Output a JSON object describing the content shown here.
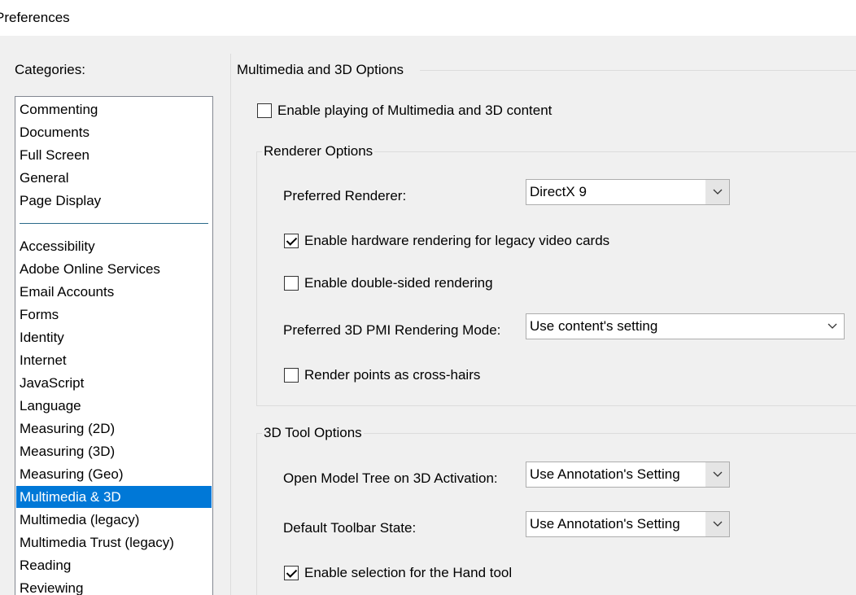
{
  "window": {
    "title": "Preferences"
  },
  "categories": {
    "label": "Categories:",
    "top_items": [
      {
        "label": "Commenting"
      },
      {
        "label": "Documents"
      },
      {
        "label": "Full Screen"
      },
      {
        "label": "General"
      },
      {
        "label": "Page Display"
      }
    ],
    "items": [
      {
        "label": "Accessibility"
      },
      {
        "label": "Adobe Online Services"
      },
      {
        "label": "Email Accounts"
      },
      {
        "label": "Forms"
      },
      {
        "label": "Identity"
      },
      {
        "label": "Internet"
      },
      {
        "label": "JavaScript"
      },
      {
        "label": "Language"
      },
      {
        "label": "Measuring (2D)"
      },
      {
        "label": "Measuring (3D)"
      },
      {
        "label": "Measuring (Geo)"
      },
      {
        "label": "Multimedia & 3D",
        "selected": true
      },
      {
        "label": "Multimedia (legacy)"
      },
      {
        "label": "Multimedia Trust (legacy)"
      },
      {
        "label": "Reading"
      },
      {
        "label": "Reviewing"
      }
    ]
  },
  "panel": {
    "title": "Multimedia and 3D Options",
    "enable_playing": {
      "label": "Enable playing of Multimedia and 3D content",
      "checked": false
    },
    "renderer": {
      "title": "Renderer Options",
      "preferred_renderer_label": "Preferred Renderer:",
      "preferred_renderer_value": "DirectX 9",
      "hw_rendering": {
        "label": "Enable hardware rendering for legacy video cards",
        "checked": true
      },
      "double_sided": {
        "label": "Enable double-sided rendering",
        "checked": false
      },
      "pmi_mode_label": "Preferred 3D PMI Rendering Mode:",
      "pmi_mode_value": "Use content's setting",
      "cross_hairs": {
        "label": "Render points as cross-hairs",
        "checked": false
      }
    },
    "tool": {
      "title": "3D Tool Options",
      "model_tree_label": "Open Model Tree on 3D Activation:",
      "model_tree_value": "Use Annotation's Setting",
      "toolbar_state_label": "Default Toolbar State:",
      "toolbar_state_value": "Use Annotation's Setting",
      "hand_tool": {
        "label": "Enable selection for the Hand tool",
        "checked": true
      }
    }
  },
  "colors": {
    "selection": "#0078d7",
    "dialog_bg": "#f0f0f0"
  }
}
